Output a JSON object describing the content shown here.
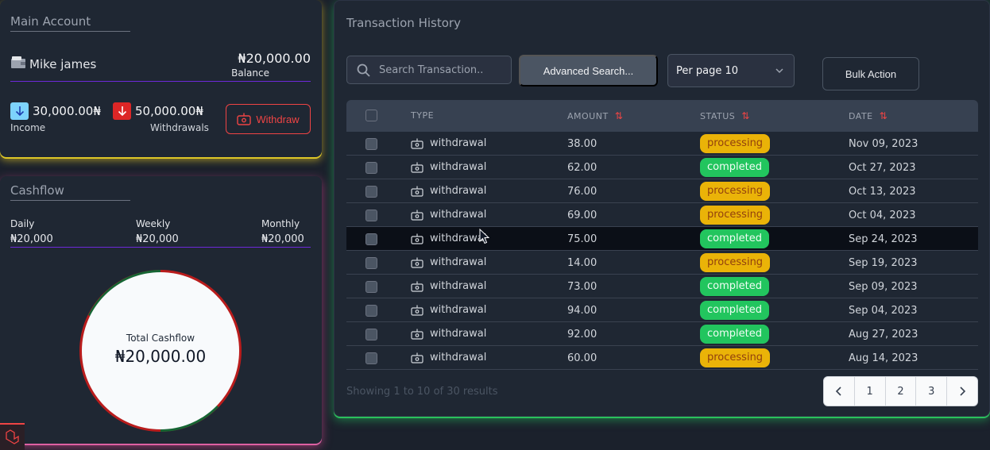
{
  "main_account": {
    "title": "Main Account",
    "account_name": "Mike james",
    "balance_value": "₦20,000.00",
    "balance_label": "Balance",
    "income_value": "30,000.00₦",
    "income_label": "Income",
    "withdrawals_value": "50,000.00₦",
    "withdrawals_label": "Withdrawals",
    "withdraw_button": "Withdraw"
  },
  "cashflow": {
    "title": "Cashflow",
    "daily_label": "Daily",
    "daily_value": "₦20,000",
    "weekly_label": "Weekly",
    "weekly_value": "₦20,000",
    "monthly_label": "Monthly",
    "monthly_value": "₦20,000",
    "total_label": "Total Cashflow",
    "total_value": "₦20,000.00"
  },
  "transactions": {
    "title": "Transaction History",
    "search_placeholder": "Search Transaction..",
    "advanced_search": "Advanced Search...",
    "per_page": "Per page 10",
    "bulk_action": "Bulk Action",
    "columns": [
      "TYPE",
      "AMOUNT",
      "STATUS",
      "DATE"
    ],
    "rows": [
      {
        "type": "withdrawal",
        "amount": "38.00",
        "status": "processing",
        "date": "Nov 09, 2023"
      },
      {
        "type": "withdrawal",
        "amount": "62.00",
        "status": "completed",
        "date": "Oct 27, 2023"
      },
      {
        "type": "withdrawal",
        "amount": "76.00",
        "status": "processing",
        "date": "Oct 13, 2023"
      },
      {
        "type": "withdrawal",
        "amount": "69.00",
        "status": "processing",
        "date": "Oct 04, 2023"
      },
      {
        "type": "withdrawal",
        "amount": "75.00",
        "status": "completed",
        "date": "Sep 24, 2023"
      },
      {
        "type": "withdrawal",
        "amount": "14.00",
        "status": "processing",
        "date": "Sep 19, 2023"
      },
      {
        "type": "withdrawal",
        "amount": "73.00",
        "status": "completed",
        "date": "Sep 09, 2023"
      },
      {
        "type": "withdrawal",
        "amount": "94.00",
        "status": "completed",
        "date": "Sep 04, 2023"
      },
      {
        "type": "withdrawal",
        "amount": "92.00",
        "status": "completed",
        "date": "Aug 27, 2023"
      },
      {
        "type": "withdrawal",
        "amount": "60.00",
        "status": "processing",
        "date": "Aug 14, 2023"
      }
    ],
    "results_text": "Showing 1 to 10 of 30 results",
    "pages": [
      "1",
      "2",
      "3"
    ]
  },
  "colors": {
    "income_accent": "#60a5fa",
    "withdraw_accent": "#ef4444",
    "processing": "#eab308",
    "completed": "#22c55e",
    "donut_red": "#b91c1c",
    "donut_green": "#166534"
  }
}
